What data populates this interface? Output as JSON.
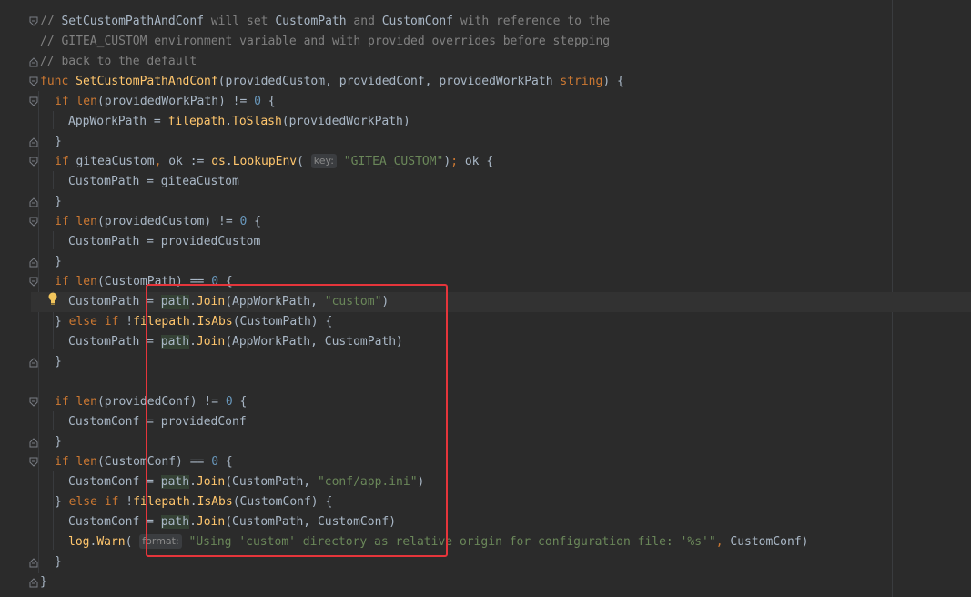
{
  "editor": {
    "language": "Go",
    "theme_colors": {
      "background": "#2b2b2b",
      "keyword": "#cc7832",
      "function": "#ffc66d",
      "string": "#6a8759",
      "number": "#6897bb",
      "comment": "#808080",
      "highlight_box": "#e5353b"
    },
    "lines": [
      {
        "text": "// SetCustomPathAndConf will set CustomPath and CustomConf with reference to the"
      },
      {
        "text": "// GITEA_CUSTOM environment variable and with provided overrides before stepping"
      },
      {
        "text": "// back to the default"
      },
      {
        "text": "func SetCustomPathAndConf(providedCustom, providedConf, providedWorkPath string) {"
      },
      {
        "text": "if len(providedWorkPath) != 0 {"
      },
      {
        "text": "AppWorkPath = filepath.ToSlash(providedWorkPath)"
      },
      {
        "text": "}"
      },
      {
        "text": "if giteaCustom, ok := os.LookupEnv( key: \"GITEA_CUSTOM\"); ok {"
      },
      {
        "text": "CustomPath = giteaCustom"
      },
      {
        "text": "}"
      },
      {
        "text": "if len(providedCustom) != 0 {"
      },
      {
        "text": "CustomPath = providedCustom"
      },
      {
        "text": "}"
      },
      {
        "text": "if len(CustomPath) == 0 {"
      },
      {
        "text": "CustomPath = path.Join(AppWorkPath, \"custom\")"
      },
      {
        "text": "} else if !filepath.IsAbs(CustomPath) {"
      },
      {
        "text": "CustomPath = path.Join(AppWorkPath, CustomPath)"
      },
      {
        "text": "}"
      },
      {
        "text": ""
      },
      {
        "text": "if len(providedConf) != 0 {"
      },
      {
        "text": "CustomConf = providedConf"
      },
      {
        "text": "}"
      },
      {
        "text": "if len(CustomConf) == 0 {"
      },
      {
        "text": "CustomConf = path.Join(CustomPath, \"conf/app.ini\")"
      },
      {
        "text": "} else if !filepath.IsAbs(CustomConf) {"
      },
      {
        "text": "CustomConf = path.Join(CustomPath, CustomConf)"
      },
      {
        "text": "log.Warn( format: \"Using 'custom' directory as relative origin for configuration file: '%s'\", CustomConf)"
      },
      {
        "text": "}"
      },
      {
        "text": "}"
      }
    ],
    "inlay_hints": {
      "key": "key:",
      "format": "format:"
    }
  }
}
